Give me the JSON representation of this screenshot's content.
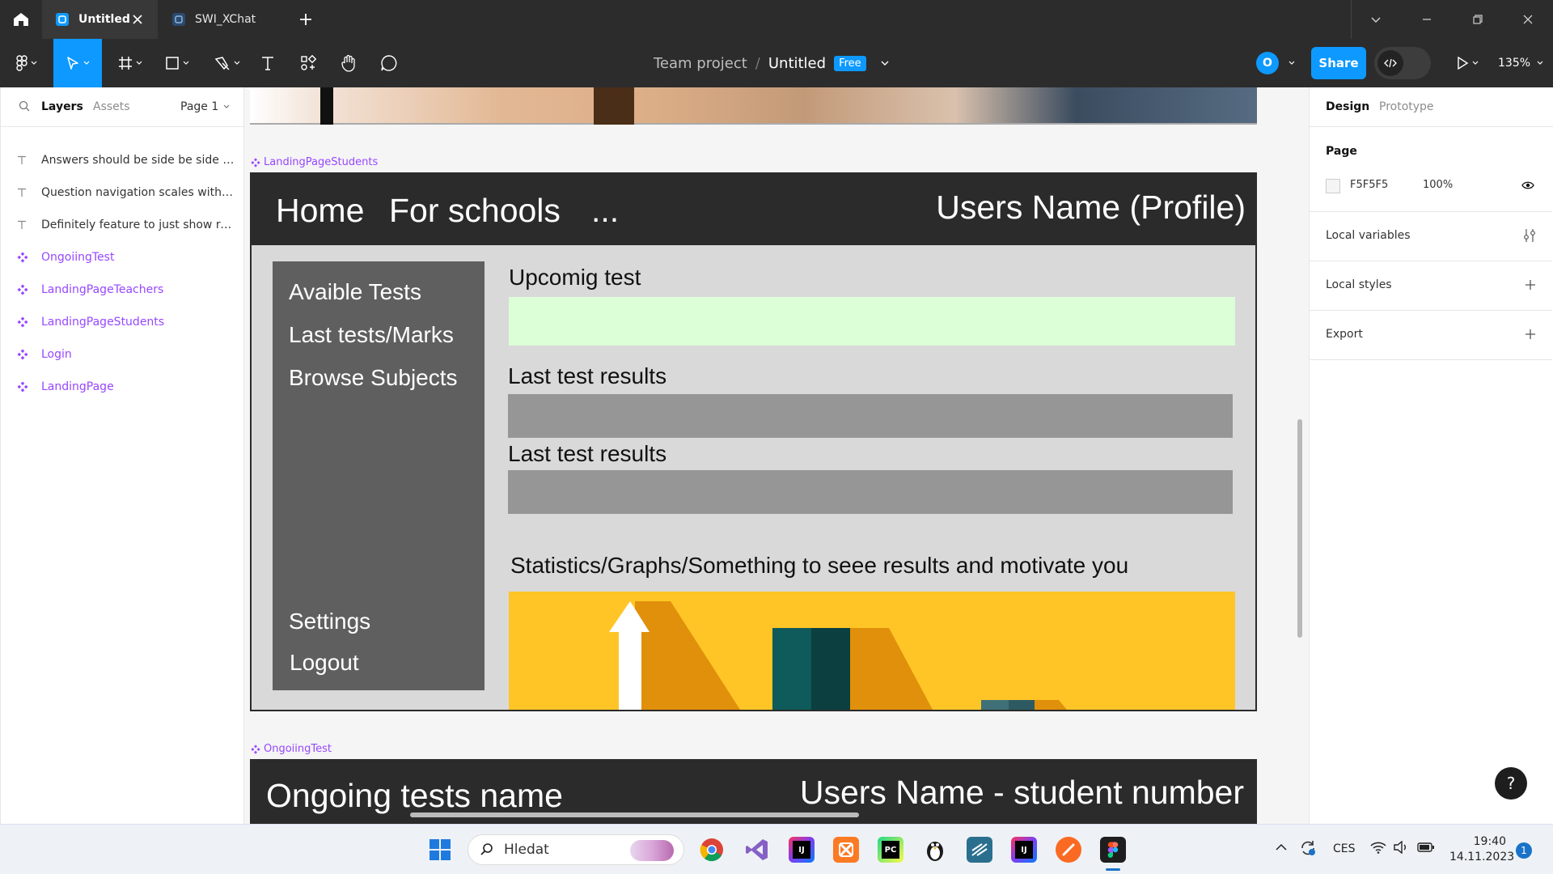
{
  "tabs": [
    {
      "title": "Untitled",
      "active": true
    },
    {
      "title": "SWI_XChat",
      "active": false
    }
  ],
  "toolbar": {
    "team": "Team project",
    "separator": "/",
    "file": "Untitled",
    "badge": "Free",
    "avatar_letter": "O",
    "share_label": "Share",
    "zoom": "135%"
  },
  "left_panel": {
    "tab_layers": "Layers",
    "tab_assets": "Assets",
    "page": "Page 1",
    "layers": [
      {
        "name": "Answers should be side be side to...",
        "type": "text-icon"
      },
      {
        "name": "Question navigation scales with qu...",
        "type": "text-icon"
      },
      {
        "name": "Definitely feature to just show rem...",
        "type": "text-icon"
      },
      {
        "name": "OngoiingTest",
        "type": "component-icon"
      },
      {
        "name": "LandingPageTeachers",
        "type": "component-icon"
      },
      {
        "name": "LandingPageStudents",
        "type": "component-icon"
      },
      {
        "name": "Login",
        "type": "component-icon"
      },
      {
        "name": "LandingPage",
        "type": "component-icon"
      }
    ]
  },
  "canvas": {
    "landing_frame_label": "LandingPageStudents",
    "landing": {
      "nav_home": "Home",
      "nav_schools": "For schools",
      "nav_more": "...",
      "profile": "Users Name (Profile)",
      "side_items": [
        "Avaible Tests",
        "Last tests/Marks",
        "Browse Subjects"
      ],
      "side_settings": "Settings",
      "side_logout": "Logout",
      "upcoming_title": "Upcomig test",
      "last_results_1": "Last test results",
      "last_results_2": "Last test results",
      "stats_title": "Statistics/Graphs/Something to seee results and motivate you"
    },
    "ongoing_frame_label": "OngoiingTest",
    "ongoing": {
      "name": "Ongoing tests name",
      "user": "Users Name - student number"
    }
  },
  "right_panel": {
    "tab_design": "Design",
    "tab_prototype": "Prototype",
    "page_title": "Page",
    "page_color": "F5F5F5",
    "page_opacity": "100%",
    "local_variables": "Local variables",
    "local_styles": "Local styles",
    "export": "Export",
    "help": "?"
  },
  "taskbar": {
    "search_label": "Hledat",
    "lang": "CES",
    "time": "19:40",
    "date": "14.11.2023",
    "notifications": "1",
    "apps": [
      "chrome-icon",
      "visual-studio-icon",
      "intellij-icon",
      "xampp-icon",
      "pycharm-icon",
      "penguin-icon",
      "network-app-icon",
      "intellij-icon-2",
      "swift-icon",
      "figma-icon"
    ]
  },
  "colors": {
    "accent": "#0d99ff",
    "component": "#9747ff",
    "chrome": "#2c2c2c",
    "upcoming_fill": "#ddffd8",
    "results_fill": "#969696",
    "graph_bg": "#ffc526"
  }
}
